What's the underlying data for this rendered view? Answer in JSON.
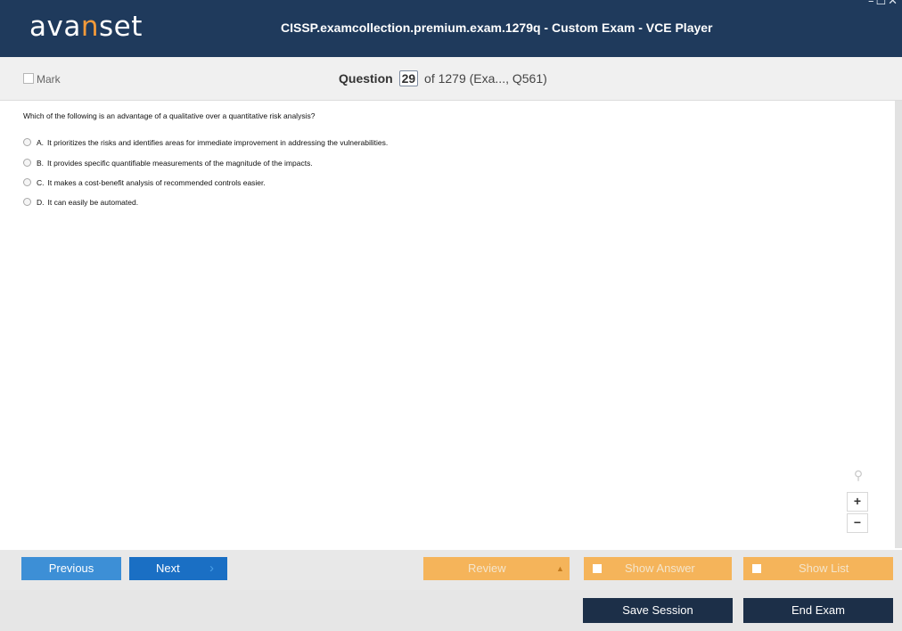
{
  "window": {
    "logo_prefix": "ava",
    "logo_accent": "n",
    "logo_suffix": "set",
    "title": "CISSP.examcollection.premium.exam.1279q - Custom Exam - VCE Player",
    "controls": [
      "–",
      "☐",
      "✕"
    ]
  },
  "question_bar": {
    "mark_label": "Mark",
    "question_label": "Question",
    "question_number": "29",
    "question_total": "of 1279 (Exa..., Q561)"
  },
  "question": {
    "text": "Which of the following is an advantage of a qualitative over a quantitative risk analysis?",
    "options": [
      {
        "letter": "A.",
        "text": "It prioritizes the risks and identifies areas for immediate improvement in addressing the vulnerabilities."
      },
      {
        "letter": "B.",
        "text": "It provides specific quantifiable measurements of the magnitude of the impacts."
      },
      {
        "letter": "C.",
        "text": "It makes a cost-benefit analysis of recommended controls easier."
      },
      {
        "letter": "D.",
        "text": "It can easily be automated."
      }
    ]
  },
  "zoom": {
    "plus": "+",
    "minus": "−"
  },
  "nav": {
    "previous": "Previous",
    "next": "Next",
    "review": "Review",
    "show_answer": "Show Answer",
    "show_list": "Show List"
  },
  "footer": {
    "save_session": "Save Session",
    "end_exam": "End Exam"
  },
  "colors": {
    "titlebar": "#1f3a5c",
    "accent": "#f39a3a",
    "primary_button": "#1a6fc4",
    "secondary_button": "#3d8fd6",
    "orange_button": "#f5b45a",
    "dark_button": "#1c2f48"
  }
}
